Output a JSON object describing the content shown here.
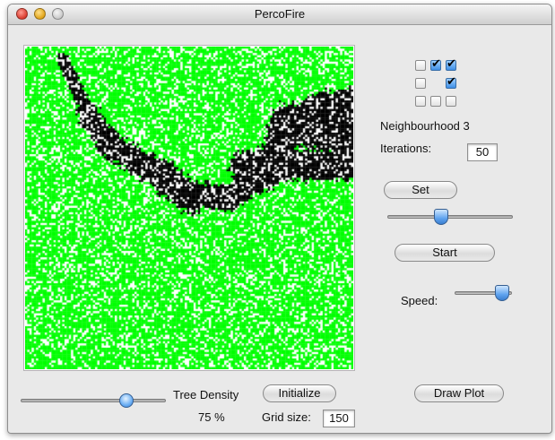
{
  "window": {
    "title": "PercoFire"
  },
  "simulation": {
    "colors": {
      "tree": "#00ff00",
      "burnt": "#000000",
      "empty": "#ffffff"
    },
    "grid_size_cells": 150
  },
  "neighbourhood": {
    "matrix": [
      [
        false,
        true,
        true
      ],
      [
        false,
        null,
        true
      ],
      [
        false,
        false,
        false
      ]
    ],
    "label": "Neighbourhood 3"
  },
  "iterations": {
    "label": "Iterations:",
    "value": "50"
  },
  "controls": {
    "set_label": "Set",
    "start_label": "Start",
    "speed_label": "Speed:",
    "draw_plot_label": "Draw Plot",
    "initialize_label": "Initialize",
    "iteration_slider_level": 0.42,
    "speed_slider_level": 0.93
  },
  "density": {
    "label": "Tree Density",
    "value_text": "75 %",
    "slider_level": 0.75
  },
  "grid_size": {
    "label": "Grid size:",
    "value": "150"
  }
}
